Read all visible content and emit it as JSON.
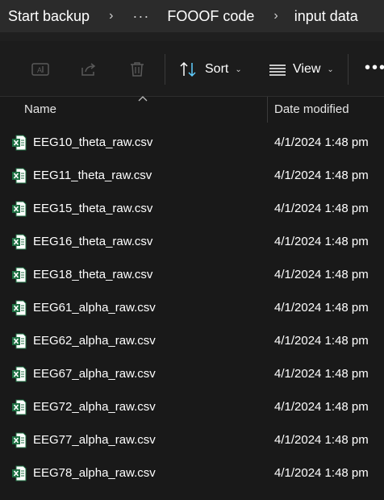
{
  "breadcrumb": {
    "items": [
      "Start backup",
      "FOOOF code",
      "input data"
    ],
    "more_label": "···",
    "separator": "›"
  },
  "toolbar": {
    "sort_label": "Sort",
    "view_label": "View",
    "more_label": "•••"
  },
  "columns": {
    "name": "Name",
    "date_modified": "Date modified"
  },
  "files": [
    {
      "name": "EEG10_theta_raw.csv",
      "date": "4/1/2024 1:48 pm"
    },
    {
      "name": "EEG11_theta_raw.csv",
      "date": "4/1/2024 1:48 pm"
    },
    {
      "name": "EEG15_theta_raw.csv",
      "date": "4/1/2024 1:48 pm"
    },
    {
      "name": "EEG16_theta_raw.csv",
      "date": "4/1/2024 1:48 pm"
    },
    {
      "name": "EEG18_theta_raw.csv",
      "date": "4/1/2024 1:48 pm"
    },
    {
      "name": "EEG61_alpha_raw.csv",
      "date": "4/1/2024 1:48 pm"
    },
    {
      "name": "EEG62_alpha_raw.csv",
      "date": "4/1/2024 1:48 pm"
    },
    {
      "name": "EEG67_alpha_raw.csv",
      "date": "4/1/2024 1:48 pm"
    },
    {
      "name": "EEG72_alpha_raw.csv",
      "date": "4/1/2024 1:48 pm"
    },
    {
      "name": "EEG77_alpha_raw.csv",
      "date": "4/1/2024 1:48 pm"
    },
    {
      "name": "EEG78_alpha_raw.csv",
      "date": "4/1/2024 1:48 pm"
    }
  ],
  "icons": {
    "file_icon": "excel-csv-icon",
    "toolbar": [
      "rename-icon",
      "share-icon",
      "delete-icon",
      "sort-icon",
      "view-icon",
      "more-icon"
    ]
  },
  "colors": {
    "excel_green": "#1d6f42",
    "background": "#191919",
    "breadcrumb_bg": "#2b2b2b"
  }
}
